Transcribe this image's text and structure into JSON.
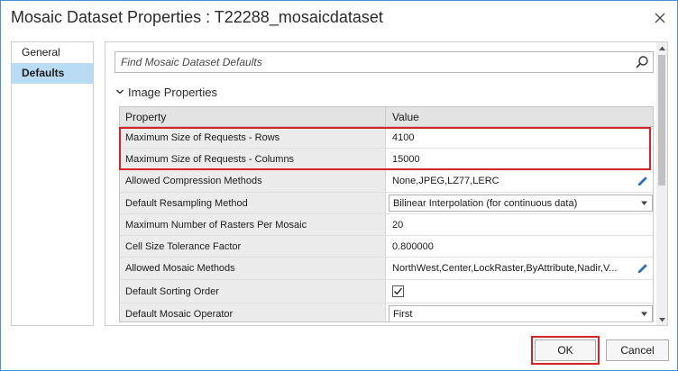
{
  "window": {
    "title": "Mosaic Dataset Properties : T22288_mosaicdataset",
    "close_icon": "close-icon"
  },
  "nav": {
    "items": [
      {
        "label": "General",
        "selected": false
      },
      {
        "label": "Defaults",
        "selected": true
      }
    ]
  },
  "search": {
    "placeholder": "Find Mosaic Dataset Defaults",
    "value": "",
    "icon": "search-icon"
  },
  "section": {
    "title": "Image Properties",
    "expanded": true
  },
  "grid": {
    "columns": {
      "property": "Property",
      "value": "Value"
    },
    "rows": [
      {
        "property": "Maximum Size of Requests - Rows",
        "value": "4100",
        "kind": "text",
        "highlighted": true
      },
      {
        "property": "Maximum Size of Requests - Columns",
        "value": "15000",
        "kind": "text",
        "highlighted": true
      },
      {
        "property": "Allowed Compression Methods",
        "value": "None,JPEG,LZ77,LERC",
        "kind": "editable-list"
      },
      {
        "property": "Default Resampling Method",
        "value": "Bilinear Interpolation (for continuous data)",
        "kind": "dropdown"
      },
      {
        "property": "Maximum Number of Rasters Per Mosaic",
        "value": "20",
        "kind": "text"
      },
      {
        "property": "Cell Size Tolerance Factor",
        "value": "0.800000",
        "kind": "text"
      },
      {
        "property": "Allowed Mosaic Methods",
        "value": "NorthWest,Center,LockRaster,ByAttribute,Nadir,V...",
        "kind": "editable-list"
      },
      {
        "property": "Default Sorting Order",
        "value": "",
        "kind": "checkbox",
        "checked": true
      },
      {
        "property": "Default Mosaic Operator",
        "value": "First",
        "kind": "dropdown"
      }
    ]
  },
  "buttons": {
    "ok": "OK",
    "cancel": "Cancel"
  },
  "colors": {
    "accent": "#b9dcf5",
    "highlight": "#d8232a",
    "window_border": "#4a8fd0"
  }
}
